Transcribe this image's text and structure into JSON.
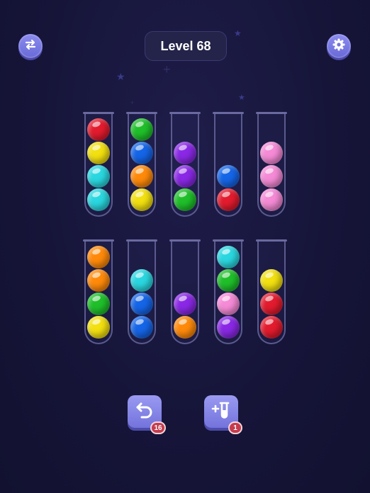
{
  "header": {
    "level_label": "Level 68",
    "left_icon": "swap-arrows-icon",
    "right_icon": "gear-icon"
  },
  "colors": {
    "red": "#e31b2e",
    "yellow": "#f2e010",
    "cyan": "#2ad7e0",
    "green": "#1fbf2a",
    "blue": "#1565e8",
    "orange": "#ff8a0a",
    "purple": "#8a28e6",
    "pink": "#f58ad6",
    "accent": "#7a7ae4"
  },
  "tubes": [
    {
      "balls_top_to_bottom": [
        "red",
        "yellow",
        "cyan",
        "cyan"
      ]
    },
    {
      "balls_top_to_bottom": [
        "green",
        "blue",
        "orange",
        "yellow"
      ]
    },
    {
      "balls_top_to_bottom": [
        "purple",
        "purple",
        "green"
      ]
    },
    {
      "balls_top_to_bottom": [
        "blue",
        "red"
      ]
    },
    {
      "balls_top_to_bottom": [
        "pink",
        "pink",
        "pink"
      ]
    },
    {
      "balls_top_to_bottom": [
        "orange",
        "orange",
        "green",
        "yellow"
      ]
    },
    {
      "balls_top_to_bottom": [
        "cyan",
        "blue",
        "blue"
      ]
    },
    {
      "balls_top_to_bottom": [
        "purple",
        "orange"
      ]
    },
    {
      "balls_top_to_bottom": [
        "cyan",
        "green",
        "pink",
        "purple"
      ]
    },
    {
      "balls_top_to_bottom": [
        "yellow",
        "red",
        "red"
      ]
    }
  ],
  "actions": {
    "undo": {
      "icon": "undo-arrow-icon",
      "count": "16"
    },
    "add_tube": {
      "icon": "add-tube-icon",
      "count": "1"
    }
  }
}
